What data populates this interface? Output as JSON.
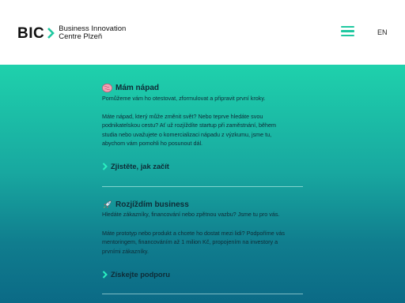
{
  "header": {
    "logo_mark": "BIC",
    "logo_line1": "Business Innovation",
    "logo_line2": "Centre Plzeň",
    "lang": "EN"
  },
  "colors": {
    "accent": "#1fc8a0",
    "gradient_top": "#1fd1ac",
    "gradient_bottom": "#0b6a86"
  },
  "cards": [
    {
      "icon": "brain-icon",
      "title": "Mám nápad",
      "lead": "Pomůžeme vám ho otestovat, zformulovat a připravit první kroky.",
      "body_lines": [
        "Máte nápad, který může změnit svět? Nebo teprve hledáte svou",
        "podnikatelskou cestu? Ať už rozjíždíte startup při zaměstnání, během",
        "studia nebo uvažujete o komercializaci nápadu z výzkumu, jsme tu,",
        "abychom vám pomohli ho posunout dál."
      ],
      "link": "Zjistěte, jak začít"
    },
    {
      "icon": "rocket-icon",
      "title": "Rozjíždím business",
      "lead": "Hledáte zákazníky, financování nebo zpětnou vazbu? Jsme tu pro vás.",
      "body_lines": [
        "Máte prototyp nebo produkt a chcete ho dostat mezi lidi? Podpoříme vás",
        "mentoringem, financováním až 1 milion Kč, propojením na investory a",
        "prvními zákazníky."
      ],
      "link": "Získejte podporu"
    }
  ]
}
